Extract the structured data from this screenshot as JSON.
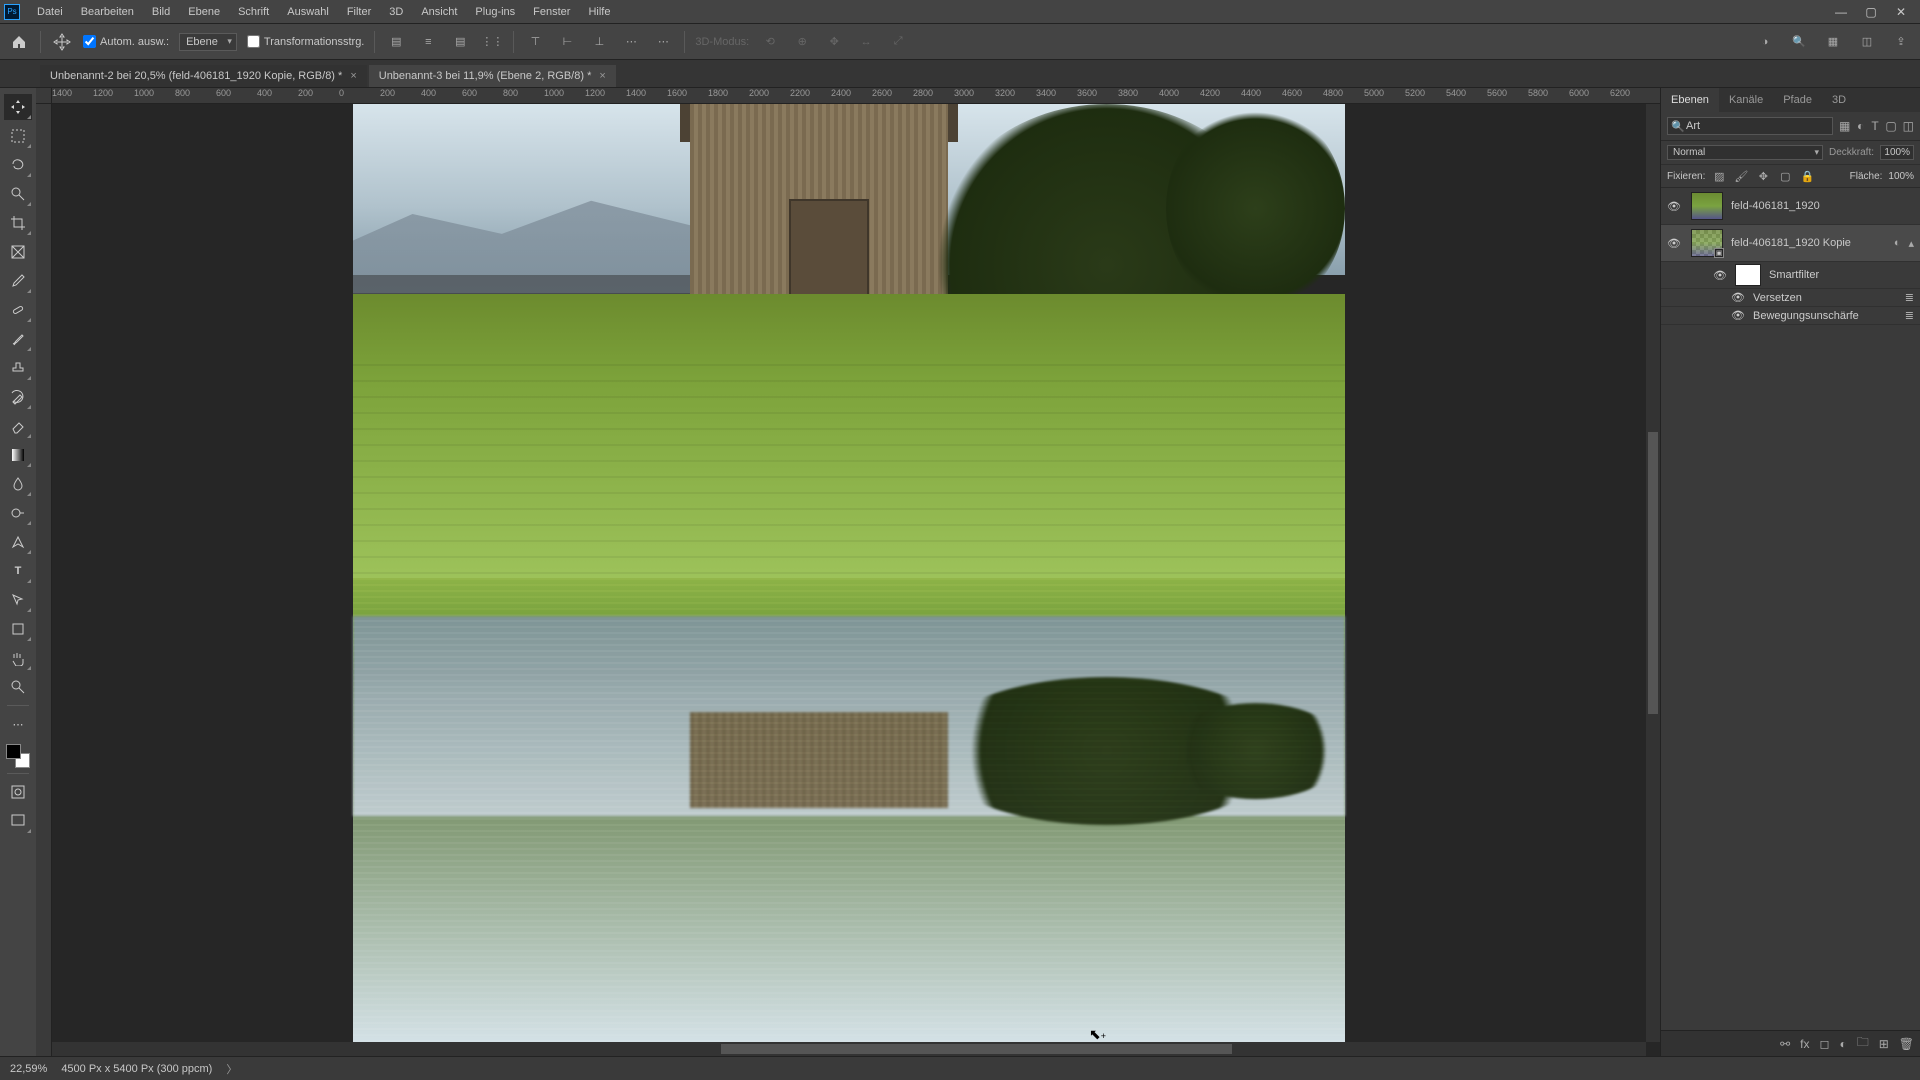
{
  "app": {
    "logo_text": "Ps"
  },
  "menu": {
    "items": [
      "Datei",
      "Bearbeiten",
      "Bild",
      "Ebene",
      "Schrift",
      "Auswahl",
      "Filter",
      "3D",
      "Ansicht",
      "Plug-ins",
      "Fenster",
      "Hilfe"
    ]
  },
  "window_controls": {
    "min": "—",
    "max": "▢",
    "close": "✕"
  },
  "options": {
    "auto_select_label": "Autom. ausw.:",
    "target_dropdown": "Ebene",
    "transform_label": "Transformationsstrg.",
    "mode_label_disabled": "3D-Modus:"
  },
  "doc_tabs": [
    {
      "title": "Unbenannt-2 bei 20,5% (feld-406181_1920 Kopie, RGB/8) *",
      "active": true
    },
    {
      "title": "Unbenannt-3 bei 11,9% (Ebene 2, RGB/8) *",
      "active": false
    }
  ],
  "ruler_ticks": [
    "1400",
    "1200",
    "1000",
    "800",
    "600",
    "400",
    "200",
    "0",
    "200",
    "400",
    "600",
    "800",
    "1000",
    "1200",
    "1400",
    "1600",
    "1800",
    "2000",
    "2200",
    "2400",
    "2600",
    "2800",
    "3000",
    "3200",
    "3400",
    "3600",
    "3800",
    "4000",
    "4200",
    "4400",
    "4600",
    "4800",
    "5000",
    "5200",
    "5400",
    "5600",
    "5800",
    "6000",
    "6200"
  ],
  "layers_panel": {
    "tabs": [
      "Ebenen",
      "Kanäle",
      "Pfade",
      "3D"
    ],
    "active_tab": 0,
    "search_placeholder": "Art",
    "blend_mode": "Normal",
    "opacity_label": "Deckkraft:",
    "opacity_value": "100%",
    "lock_label": "Fixieren:",
    "fill_label": "Fläche:",
    "fill_value": "100%",
    "layers": [
      {
        "name": "feld-406181_1920",
        "visible": true,
        "selected": false,
        "thumb": "image"
      },
      {
        "name": "feld-406181_1920 Kopie",
        "visible": true,
        "selected": true,
        "thumb": "smart",
        "has_effects": true
      }
    ],
    "smart_filters_label": "Smartfilter",
    "filters": [
      {
        "name": "Versetzen",
        "visible": true
      },
      {
        "name": "Bewegungsunschärfe",
        "visible": true
      }
    ]
  },
  "status_bar": {
    "zoom": "22,59%",
    "doc_info": "4500 Px x 5400 Px (300 ppcm)",
    "nav": "〉"
  },
  "icons": {
    "eye": "👁",
    "search": "🔍",
    "home": "⌂",
    "share": "⇪",
    "grid": "▦"
  }
}
